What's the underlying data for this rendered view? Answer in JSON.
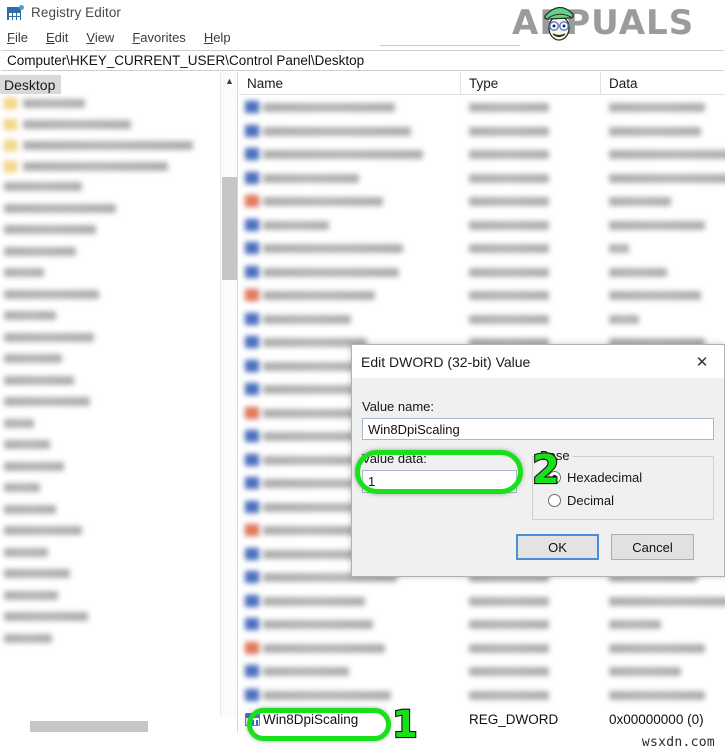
{
  "window": {
    "title": "Registry Editor",
    "icon": "registry-editor-icon"
  },
  "menubar": {
    "items": [
      {
        "label": "File",
        "accel": "F",
        "rest": "ile"
      },
      {
        "label": "Edit",
        "accel": "E",
        "rest": "dit"
      },
      {
        "label": "View",
        "accel": "V",
        "rest": "iew"
      },
      {
        "label": "Favorites",
        "accel": "F",
        "rest": "avorites"
      },
      {
        "label": "Help",
        "accel": "H",
        "rest": "elp"
      }
    ]
  },
  "addressbar": {
    "path": "Computer\\HKEY_CURRENT_USER\\Control Panel\\Desktop"
  },
  "tree": {
    "selected_node": "Desktop",
    "scroll_up_icon": "chevron-up-icon",
    "scroll_down_icon": "chevron-down-icon",
    "child_nodes_blurred_count": 4,
    "sibling_nodes_blurred_count": 22
  },
  "list": {
    "columns": [
      "Name",
      "Type",
      "Data"
    ],
    "selected_row": {
      "name": "Win8DpiScaling",
      "type": "REG_DWORD",
      "data": "0x00000000 (0)",
      "icon": "dword-value-icon"
    },
    "blurred_row_count": 26
  },
  "dialog": {
    "title": "Edit DWORD (32-bit) Value",
    "close_icon": "close-icon",
    "value_name_label": "Value name:",
    "value_name": "Win8DpiScaling",
    "value_data_label": "Value data:",
    "value_data": "1",
    "base": {
      "group_label": "Base",
      "options": [
        {
          "label": "Hexadecimal",
          "selected": true
        },
        {
          "label": "Decimal",
          "selected": false
        }
      ]
    },
    "buttons": {
      "ok": "OK",
      "cancel": "Cancel"
    }
  },
  "annotations": {
    "step_one": "1",
    "step_two": "2",
    "highlight_color": "#18e01a"
  },
  "watermarks": {
    "brand": "APPUALS",
    "site": "wsxdn.com"
  }
}
